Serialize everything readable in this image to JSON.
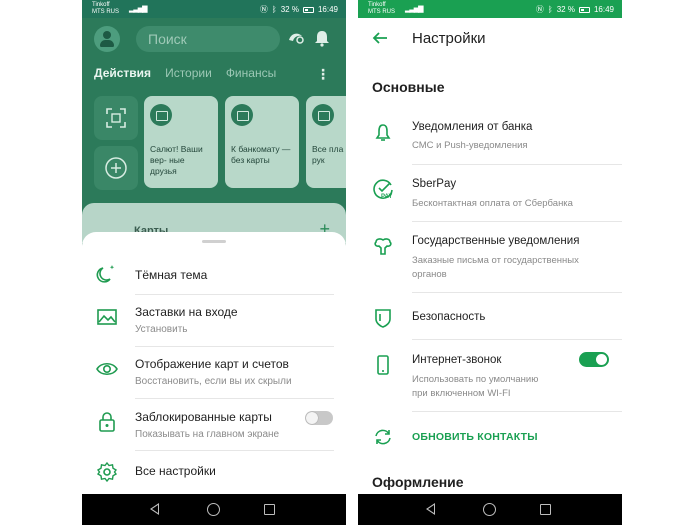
{
  "left": {
    "status": {
      "carrier_line1": "Tinkoff",
      "carrier_line2": "MTS RUS",
      "battery": "32 %",
      "time": "16:49"
    },
    "header": {
      "search_placeholder": "Поиск"
    },
    "tabs": [
      "Действия",
      "Истории",
      "Финансы"
    ],
    "cards": [
      {
        "text": "Салют! Ваши вер- ные друзья"
      },
      {
        "text": "К банкомату — без карты"
      },
      {
        "text": "Все пла под рук"
      }
    ],
    "under_sheet_label": "Карты",
    "sheet": {
      "items": [
        {
          "title": "Тёмная тема",
          "subtitle": "",
          "icon": "moon-icon"
        },
        {
          "title": "Заставки на входе",
          "subtitle": "Установить",
          "icon": "image-icon"
        },
        {
          "title": "Отображение карт и счетов",
          "subtitle": "Восстановить, если вы их скрыли",
          "icon": "eye-icon"
        },
        {
          "title": "Заблокированные карты",
          "subtitle": "Показывать на главном экране",
          "icon": "lock-icon"
        },
        {
          "title": "Все настройки",
          "subtitle": "",
          "icon": "gear-icon"
        }
      ],
      "blocked_cards_toggle": false
    }
  },
  "right": {
    "status": {
      "carrier_line1": "Tinkoff",
      "carrier_line2": "MTS RUS",
      "battery": "32 %",
      "time": "16:49"
    },
    "title": "Настройки",
    "section_main": "Основные",
    "items": [
      {
        "title": "Уведомления от банка",
        "subtitle": "СМС и Push-уведомления",
        "icon": "bell-icon"
      },
      {
        "title": "SberPay",
        "subtitle": "Бесконтактная оплата от Сбербанка",
        "icon": "sberpay-icon"
      },
      {
        "title": "Государственные уведомления",
        "subtitle1": "Заказные письма от государственных",
        "subtitle2": "органов",
        "icon": "government-icon"
      },
      {
        "title": "Безопасность",
        "icon": "shield-icon"
      },
      {
        "title": "Интернет-звонок",
        "subtitle1": "Использовать по умолчанию",
        "subtitle2": "при включенном WI-FI",
        "icon": "phone-icon",
        "toggle": true
      }
    ],
    "action": "ОБНОВИТЬ КОНТАКТЫ",
    "section_design": "Оформление"
  },
  "colors": {
    "accent": "#1aa052",
    "left_bg": "#2c7a5a"
  }
}
